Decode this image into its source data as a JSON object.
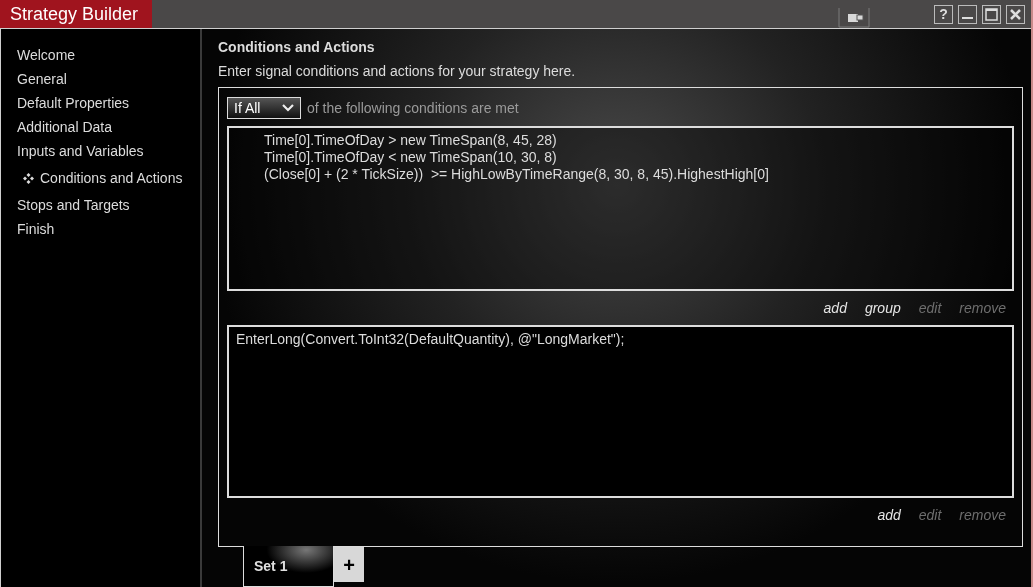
{
  "window": {
    "title": "Strategy Builder",
    "buttons": [
      "?"
    ]
  },
  "sidebar": {
    "items": [
      {
        "label": "Welcome",
        "selected": false
      },
      {
        "label": "General",
        "selected": false
      },
      {
        "label": "Default Properties",
        "selected": false
      },
      {
        "label": "Additional Data",
        "selected": false
      },
      {
        "label": "Inputs and Variables",
        "selected": false
      },
      {
        "label": "Conditions and Actions",
        "selected": true
      },
      {
        "label": "Stops and Targets",
        "selected": false
      },
      {
        "label": "Finish",
        "selected": false
      }
    ]
  },
  "page": {
    "heading": "Conditions and Actions",
    "description": "Enter signal conditions and actions for your strategy here."
  },
  "conditions": {
    "mode": "If All",
    "mode_suffix": "of the following conditions are met",
    "lines": [
      "Time[0].TimeOfDay > new TimeSpan(8, 45, 28)",
      "Time[0].TimeOfDay < new TimeSpan(10, 30, 8)",
      "(Close[0] + (2 * TickSize))  >= HighLowByTimeRange(8, 30, 8, 45).HighestHigh[0]"
    ],
    "links": [
      {
        "label": "add",
        "disabled": false
      },
      {
        "label": "group",
        "disabled": false
      },
      {
        "label": "edit",
        "disabled": true
      },
      {
        "label": "remove",
        "disabled": true
      }
    ]
  },
  "actions": {
    "lines": [
      "EnterLong(Convert.ToInt32(DefaultQuantity), @\"LongMarket\");"
    ],
    "links": [
      {
        "label": "add",
        "disabled": false
      },
      {
        "label": "edit",
        "disabled": true
      },
      {
        "label": "remove",
        "disabled": true
      }
    ]
  },
  "sets": {
    "tabs": [
      {
        "label": "Set 1",
        "selected": true
      }
    ],
    "add_label": "+"
  }
}
